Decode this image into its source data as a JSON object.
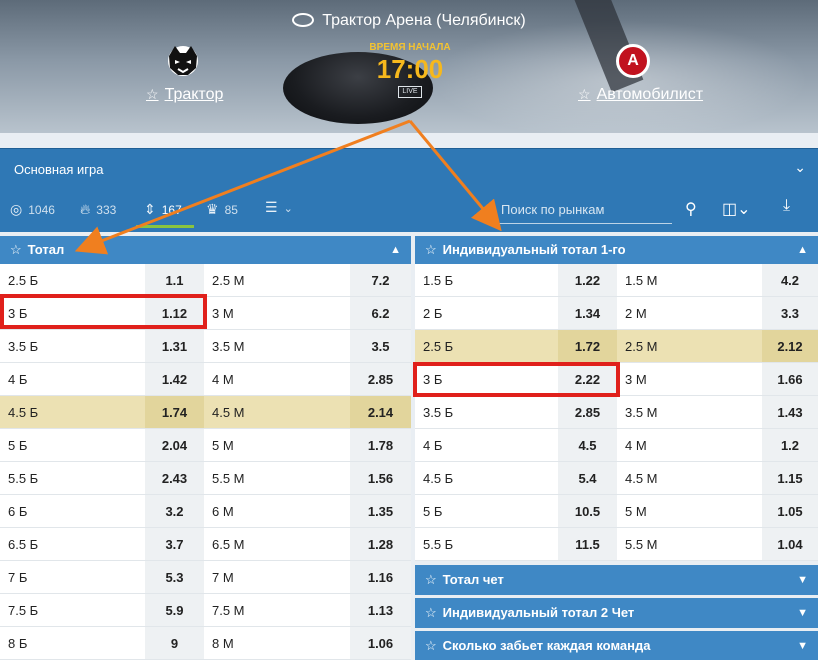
{
  "header": {
    "venue": "Трактор Арена (Челябинск)",
    "start_label": "ВРЕМЯ НАЧАЛА",
    "start_time": "17:00",
    "live_badge": "LIVE",
    "home_team": "Трактор",
    "away_team": "Автомобилист",
    "away_logo_letter": "А"
  },
  "market_select": {
    "label": "Основная игра"
  },
  "toolbar": {
    "counts": [
      {
        "icon": "target-icon",
        "value": "1046"
      },
      {
        "icon": "flame-icon",
        "value": "333"
      },
      {
        "icon": "sort-icon",
        "value": "167"
      },
      {
        "icon": "trophy-icon",
        "value": "85"
      }
    ],
    "search_placeholder": "Поиск по рынкам"
  },
  "total_market": {
    "title": "Тотал",
    "rows": [
      {
        "over": "2.5 Б",
        "over_odd": "1.1",
        "under": "2.5 М",
        "under_odd": "7.2"
      },
      {
        "over": "3 Б",
        "over_odd": "1.12",
        "under": "3 М",
        "under_odd": "6.2"
      },
      {
        "over": "3.5 Б",
        "over_odd": "1.31",
        "under": "3.5 М",
        "under_odd": "3.5"
      },
      {
        "over": "4 Б",
        "over_odd": "1.42",
        "under": "4 М",
        "under_odd": "2.85"
      },
      {
        "over": "4.5 Б",
        "over_odd": "1.74",
        "under": "4.5 М",
        "under_odd": "2.14"
      },
      {
        "over": "5 Б",
        "over_odd": "2.04",
        "under": "5 М",
        "under_odd": "1.78"
      },
      {
        "over": "5.5 Б",
        "over_odd": "2.43",
        "under": "5.5 М",
        "under_odd": "1.56"
      },
      {
        "over": "6 Б",
        "over_odd": "3.2",
        "under": "6 М",
        "under_odd": "1.35"
      },
      {
        "over": "6.5 Б",
        "over_odd": "3.7",
        "under": "6.5 М",
        "under_odd": "1.28"
      },
      {
        "over": "7 Б",
        "over_odd": "5.3",
        "under": "7 М",
        "under_odd": "1.16"
      },
      {
        "over": "7.5 Б",
        "over_odd": "5.9",
        "under": "7.5 М",
        "under_odd": "1.13"
      },
      {
        "over": "8 Б",
        "over_odd": "9",
        "under": "8 М",
        "under_odd": "1.06"
      }
    ]
  },
  "individual_total_1": {
    "title": "Индивидуальный тотал 1-го",
    "rows": [
      {
        "over": "1.5 Б",
        "over_odd": "1.22",
        "under": "1.5 М",
        "under_odd": "4.2"
      },
      {
        "over": "2 Б",
        "over_odd": "1.34",
        "under": "2 М",
        "under_odd": "3.3"
      },
      {
        "over": "2.5 Б",
        "over_odd": "1.72",
        "under": "2.5 М",
        "under_odd": "2.12"
      },
      {
        "over": "3 Б",
        "over_odd": "2.22",
        "under": "3 М",
        "under_odd": "1.66"
      },
      {
        "over": "3.5 Б",
        "over_odd": "2.85",
        "under": "3.5 М",
        "under_odd": "1.43"
      },
      {
        "over": "4 Б",
        "over_odd": "4.5",
        "under": "4 М",
        "under_odd": "1.2"
      },
      {
        "over": "4.5 Б",
        "over_odd": "5.4",
        "under": "4.5 М",
        "under_odd": "1.15"
      },
      {
        "over": "5 Б",
        "over_odd": "10.5",
        "under": "5 М",
        "under_odd": "1.05"
      },
      {
        "over": "5.5 Б",
        "over_odd": "11.5",
        "under": "5.5 М",
        "under_odd": "1.04"
      }
    ]
  },
  "collapsed_markets": [
    {
      "title": "Тотал чет"
    },
    {
      "title": "Индивидуальный тотал 2 Чет"
    },
    {
      "title": "Сколько забьет каждая команда"
    }
  ]
}
